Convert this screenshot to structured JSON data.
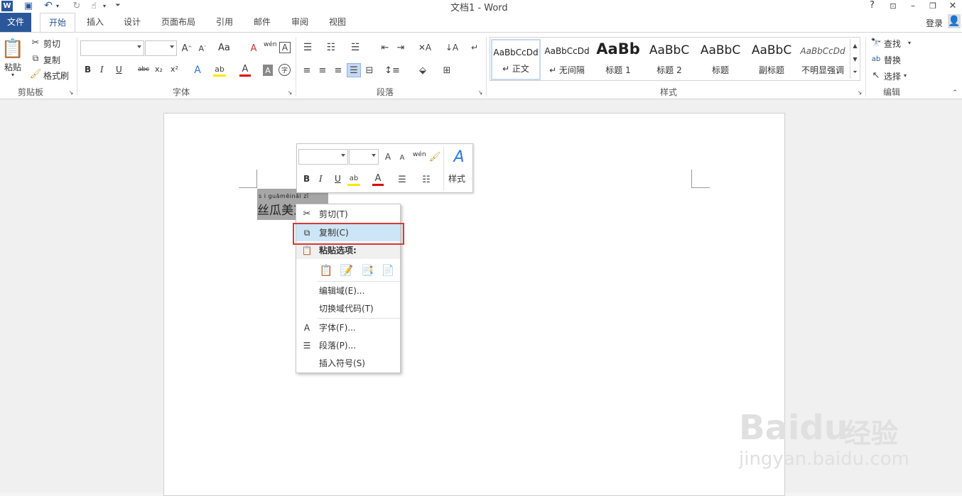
{
  "window": {
    "title": "文档1 - Word",
    "help": "?",
    "login": "登录"
  },
  "tabs": [
    {
      "label": "文件"
    },
    {
      "label": "开始"
    },
    {
      "label": "插入"
    },
    {
      "label": "设计"
    },
    {
      "label": "页面布局"
    },
    {
      "label": "引用"
    },
    {
      "label": "邮件"
    },
    {
      "label": "审阅"
    },
    {
      "label": "视图"
    }
  ],
  "clipboard": {
    "paste": "粘贴",
    "cut": "剪切",
    "copy": "复制",
    "format_painter": "格式刷",
    "group": "剪贴板"
  },
  "font": {
    "group": "字体",
    "name_value": "",
    "size_value": "",
    "case_btn": "Aa",
    "phonetic": "wén",
    "bold": "B",
    "italic": "I",
    "underline": "U",
    "strike": "abc",
    "sub": "x₂",
    "sup": "x²"
  },
  "paragraph": {
    "group": "段落"
  },
  "styles": {
    "group": "样式",
    "items": [
      {
        "sample": "AaBbCcDd",
        "name": "↵ 正文"
      },
      {
        "sample": "AaBbCcDd",
        "name": "↵ 无间隔"
      },
      {
        "sample": "AaBb",
        "name": "标题 1"
      },
      {
        "sample": "AaBbC",
        "name": "标题 2"
      },
      {
        "sample": "AaBbC",
        "name": "标题"
      },
      {
        "sample": "AaBbC",
        "name": "副标题"
      },
      {
        "sample": "AaBbCcDd",
        "name": "不明显强调"
      }
    ]
  },
  "editing": {
    "group": "编辑",
    "find": "查找",
    "replace": "替换",
    "select": "选择"
  },
  "document": {
    "text": "丝瓜美东了",
    "ruby": "s i guāmēinǎi zǐ"
  },
  "minitoolbar": {
    "styles_label": "样式",
    "bold": "B",
    "italic": "I",
    "underline": "U",
    "phonetic": "wén"
  },
  "context_menu": {
    "cut": "剪切(T)",
    "copy": "复制(C)",
    "paste_options": "粘贴选项:",
    "edit_field": "编辑域(E)...",
    "toggle_field": "切换域代码(T)",
    "font": "字体(F)...",
    "paragraph": "段落(P)...",
    "insert_symbol": "插入符号(S)"
  },
  "watermark": {
    "brand": "Baidu",
    "cn": "经验",
    "url": "jingyan.baidu.com"
  },
  "colors": {
    "word_blue": "#2b579a",
    "highlight_red": "#d9393a",
    "menu_hover": "#cde6f7"
  }
}
